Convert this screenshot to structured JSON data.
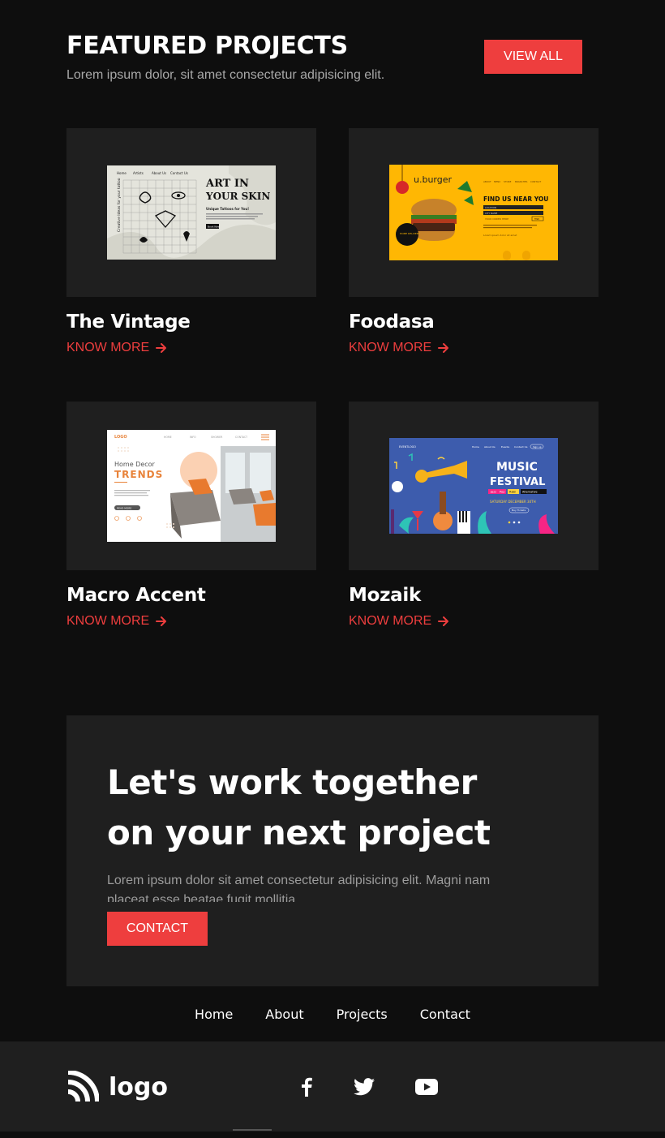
{
  "featured": {
    "title": "FEATURED PROJECTS",
    "subtitle": "Lorem ipsum dolor, sit amet consectetur adipisicing elit.",
    "view_all_label": "VIEW ALL"
  },
  "projects": [
    {
      "name": "The Vintage",
      "link_label": "KNOW MORE",
      "thumb_text": [
        "ART IN",
        "YOUR SKIN",
        "Unique Tattoos for You!",
        "Home",
        "Artists",
        "About Us",
        "Contact Us",
        "Creative Ideas for your tattoo",
        "Book Now"
      ]
    },
    {
      "name": "Foodasa",
      "link_label": "KNOW MORE",
      "thumb_text": [
        "u.burger",
        "FIND US NEAR YOU",
        "HOME DELIVERY",
        "YOUR ORDER HERE",
        "FIND",
        "LOCATION",
        "CITY NAME",
        "ABOUT",
        "MENU",
        "STORE",
        "BRANCHES",
        "CONTACT",
        "Lorem ipsum dolor sit amet"
      ]
    },
    {
      "name": "Macro Accent",
      "link_label": "KNOW MORE",
      "thumb_text": [
        "LOGO",
        "HOME",
        "INFO",
        "CONTACT",
        "SHOWER",
        "Home Decor",
        "TRENDS",
        "READ MORE"
      ]
    },
    {
      "name": "Mozaik",
      "link_label": "KNOW MORE",
      "thumb_text": [
        "EVENTLOGO",
        "Home",
        "About Us",
        "Events",
        "Contact Us",
        "Sign up",
        "MUSIC",
        "FESTIVAL",
        "Jazz",
        "Pop",
        "R&B",
        "Alternative",
        "SATURDAY DECEMBER 30TH",
        "Buy Tickets"
      ]
    }
  ],
  "cta": {
    "heading": "Let's work together on your next project",
    "body": "Lorem ipsum dolor sit amet consectetur adipisicing elit. Magni nam placeat esse beatae fugit mollitia",
    "button_label": "CONTACT"
  },
  "nav": {
    "items": [
      "Home",
      "About",
      "Projects",
      "Contact"
    ]
  },
  "footer": {
    "logo_text": "logo",
    "socials": [
      "facebook-icon",
      "twitter-icon",
      "youtube-icon"
    ]
  },
  "colors": {
    "accent": "#ee3e3e",
    "background": "#0e0e0e",
    "panel": "#1f1f1f",
    "muted_text": "#a8a8a8"
  }
}
